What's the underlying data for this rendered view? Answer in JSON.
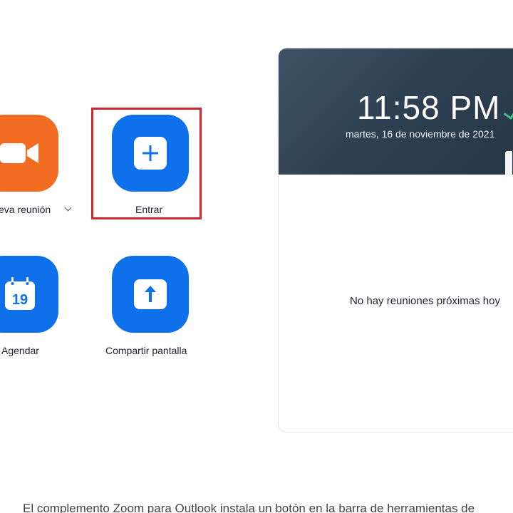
{
  "actions": {
    "new_meeting": {
      "label": "eva reunión",
      "icon": "video-camera-icon"
    },
    "join": {
      "label": "Entrar",
      "icon": "plus-icon"
    },
    "schedule": {
      "label": "Agendar",
      "icon": "calendar-icon",
      "calendar_day": "19"
    },
    "share_screen": {
      "label": "Compartir pantalla",
      "icon": "arrow-up-icon"
    }
  },
  "panel": {
    "time": "11:58 PM",
    "date": "martes, 16 de noviembre de 2021",
    "empty_message": "No hay reuniones próximas hoy"
  },
  "caption": "El complemento Zoom para Outlook instala un botón en la barra de herramientas de",
  "colors": {
    "orange": "#f26d21",
    "blue": "#0e71eb",
    "highlight": "#d0262f",
    "header_bg": "#2c3e50"
  }
}
